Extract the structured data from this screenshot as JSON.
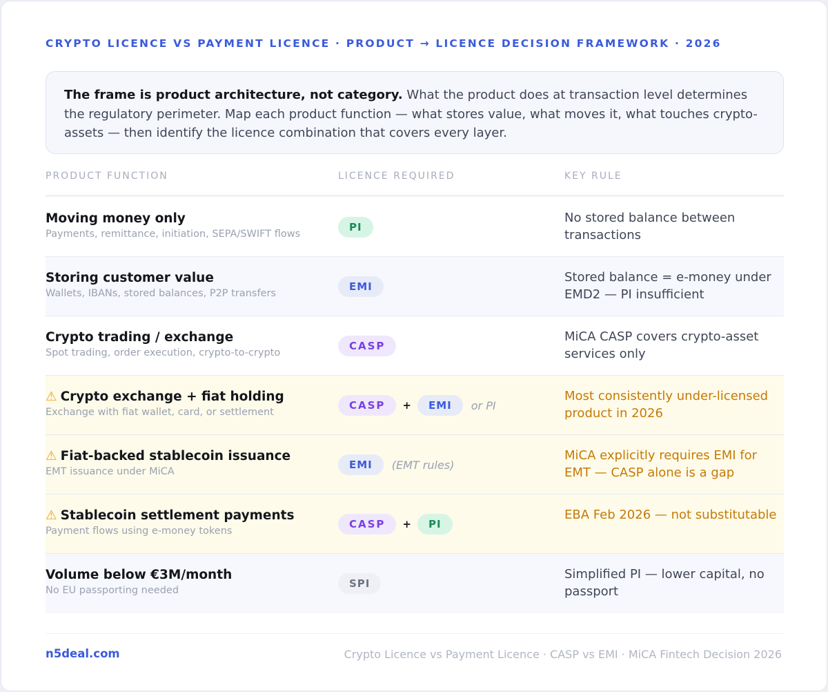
{
  "header": {
    "eyebrow": "CRYPTO LICENCE VS PAYMENT LICENCE · PRODUCT → LICENCE DECISION FRAMEWORK · 2026"
  },
  "intro": {
    "lead": "The frame is product architecture, not category.",
    "body": " What the product does at transaction level determines the regulatory perimeter. Map each product function — what stores value, what moves it, what touches crypto-assets — then identify the licence combination that covers every layer."
  },
  "table": {
    "headers": [
      "PRODUCT FUNCTION",
      "LICENCE REQUIRED",
      "KEY RULE"
    ],
    "rows": [
      {
        "title": "Moving money only",
        "subtitle": "Payments, remittance, initiation, SEPA/SWIFT flows",
        "licences": [
          "PI"
        ],
        "licence_kinds": [
          "pi"
        ],
        "note": "",
        "rule": "No stored balance between transactions",
        "warning": false
      },
      {
        "title": "Storing customer value",
        "subtitle": "Wallets, IBANs, stored balances, P2P transfers",
        "licences": [
          "EMI"
        ],
        "licence_kinds": [
          "emi"
        ],
        "note": "",
        "rule": "Stored balance = e-money under EMD2 — PI insufficient",
        "warning": false
      },
      {
        "title": "Crypto trading / exchange",
        "subtitle": "Spot trading, order execution, crypto-to-crypto",
        "licences": [
          "CASP"
        ],
        "licence_kinds": [
          "casp"
        ],
        "note": "",
        "rule": "MiCA CASP covers crypto-asset services only",
        "warning": false
      },
      {
        "title": "Crypto exchange + fiat holding",
        "subtitle": "Exchange with fiat wallet, card, or settlement",
        "licences": [
          "CASP",
          "EMI"
        ],
        "licence_kinds": [
          "casp",
          "emi"
        ],
        "note": "or PI",
        "rule": "Most consistently under-licensed product in 2026",
        "warning": true
      },
      {
        "title": "Fiat-backed stablecoin issuance",
        "subtitle": "EMT issuance under MiCA",
        "licences": [
          "EMI"
        ],
        "licence_kinds": [
          "emi"
        ],
        "note": "(EMT rules)",
        "rule": "MiCA explicitly requires EMI for EMT — CASP alone is a gap",
        "warning": true
      },
      {
        "title": "Stablecoin settlement payments",
        "subtitle": "Payment flows using e-money tokens",
        "licences": [
          "CASP",
          "PI"
        ],
        "licence_kinds": [
          "casp",
          "pi"
        ],
        "note": "",
        "rule": "EBA Feb 2026 — not substitutable",
        "warning": true
      },
      {
        "title": "Volume below €3M/month",
        "subtitle": "No EU passporting needed",
        "licences": [
          "SPI"
        ],
        "licence_kinds": [
          "spi"
        ],
        "note": "",
        "rule": "Simplified PI — lower capital, no passport",
        "warning": false
      }
    ],
    "plus_symbol": "+",
    "warning_symbol": "⚠"
  },
  "footer": {
    "brand": "n5deal.com",
    "note": "Crypto Licence vs Payment Licence · CASP vs EMI · MiCA Fintech Decision 2026"
  },
  "colors": {
    "accent": "#3b5bdb",
    "warning_text": "#c57a06",
    "warning_row": "#fefbea",
    "pi_pill": "#d6f5e5",
    "emi_pill": "#e7ebf8",
    "casp_pill": "#efe8fc",
    "spi_pill": "#eef0f4"
  }
}
